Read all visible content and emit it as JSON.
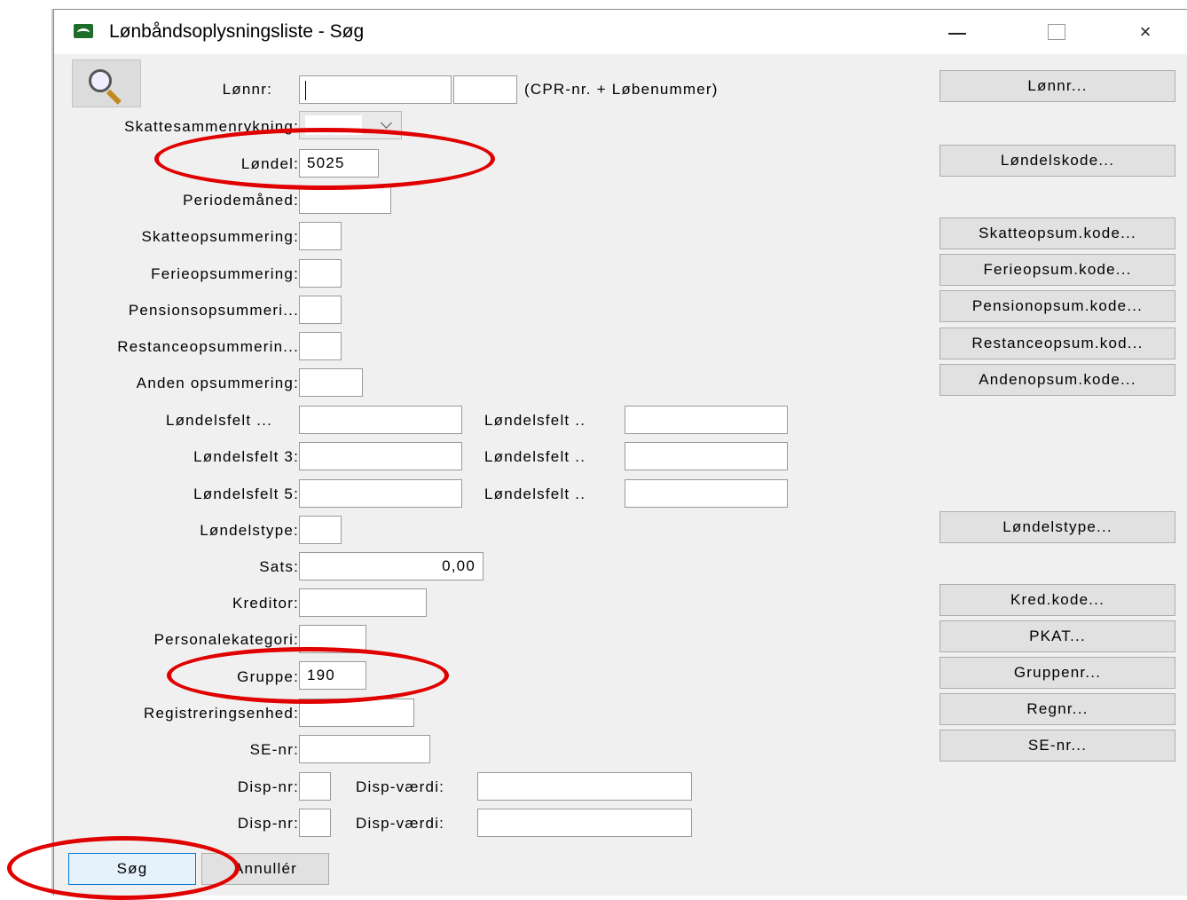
{
  "window": {
    "title": "Lønbåndsoplysningsliste - Søg",
    "min_glyph": "",
    "max_glyph": "",
    "close_glyph": "×"
  },
  "fields": {
    "lonnr": {
      "label": "Lønnr:",
      "value": "",
      "hint": "(CPR-nr. + Løbenummer)"
    },
    "skat": {
      "label": "Skattesammenrykning:",
      "value": ""
    },
    "londel": {
      "label": "Løndel:",
      "value": "5025"
    },
    "periode": {
      "label": "Periodemåned:",
      "value": ""
    },
    "skatteop": {
      "label": "Skatteopsummering:",
      "value": ""
    },
    "ferieop": {
      "label": "Ferieopsummering:",
      "value": ""
    },
    "pensionop": {
      "label": "Pensionsopsummeri...",
      "value": ""
    },
    "restanceop": {
      "label": "Restanceopsummerin...",
      "value": ""
    },
    "andenop": {
      "label": "Anden opsummering:",
      "value": ""
    },
    "lf1": {
      "label": "Løndelsfelt ...",
      "value": ""
    },
    "lf2": {
      "label": "Løndelsfelt ..",
      "value": ""
    },
    "lf3": {
      "label": "Løndelsfelt 3:",
      "value": ""
    },
    "lf4": {
      "label": "Løndelsfelt ..",
      "value": ""
    },
    "lf5": {
      "label": "Løndelsfelt 5:",
      "value": ""
    },
    "lf6": {
      "label": "Løndelsfelt ..",
      "value": ""
    },
    "londelstype": {
      "label": "Løndelstype:",
      "value": ""
    },
    "sats": {
      "label": "Sats:",
      "value": "0,00"
    },
    "kreditor": {
      "label": "Kreditor:",
      "value": ""
    },
    "pkat": {
      "label": "Personalekategori:",
      "value": ""
    },
    "gruppe": {
      "label": "Gruppe:",
      "value": "190"
    },
    "reg": {
      "label": "Registreringsenhed:",
      "value": ""
    },
    "se": {
      "label": "SE-nr:",
      "value": ""
    },
    "disp1": {
      "nr_label": "Disp-nr:",
      "nr_value": "",
      "val_label": "Disp-værdi:",
      "val_value": ""
    },
    "disp2": {
      "nr_label": "Disp-nr:",
      "nr_value": "",
      "val_label": "Disp-værdi:",
      "val_value": ""
    }
  },
  "lookup_buttons": {
    "lonnr": "Lønnr...",
    "londelskode": "Løndelskode...",
    "skatteopsum": "Skatteopsum.kode...",
    "ferieopsum": "Ferieopsum.kode...",
    "pensionopsum": "Pensionopsum.kode...",
    "restanceopsum": "Restanceopsum.kod...",
    "andenopsum": "Andenopsum.kode...",
    "londelstype": "Løndelstype...",
    "kredkode": "Kred.kode...",
    "pkat": "PKAT...",
    "gruppenr": "Gruppenr...",
    "regnr": "Regnr...",
    "senr": "SE-nr..."
  },
  "actions": {
    "search": "Søg",
    "cancel": "Annullér"
  },
  "colors": {
    "annotation": "#e00000",
    "primary_border": "#0078d7"
  }
}
